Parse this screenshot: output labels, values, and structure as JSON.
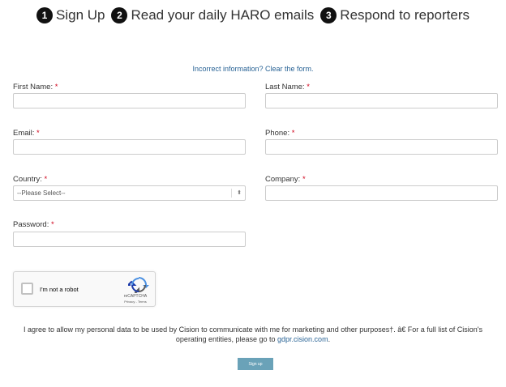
{
  "steps": [
    {
      "num": "1",
      "label": "Sign Up"
    },
    {
      "num": "2",
      "label": "Read your daily HARO emails"
    },
    {
      "num": "3",
      "label": "Respond to reporters"
    }
  ],
  "form": {
    "clear_link": "Incorrect information? Clear the form.",
    "required_mark": "*",
    "first_name_label": "First Name:",
    "last_name_label": "Last Name:",
    "email_label": "Email:",
    "phone_label": "Phone:",
    "country_label": "Country:",
    "company_label": "Company:",
    "password_label": "Password:",
    "country_value": "--Please Select--",
    "first_name_value": "",
    "last_name_value": "",
    "email_value": "",
    "phone_value": "",
    "company_value": "",
    "password_value": ""
  },
  "recaptcha": {
    "label": "I'm not a robot",
    "brand": "reCAPTCHA",
    "links": "Privacy - Terms"
  },
  "consent": {
    "text": "I agree to allow my personal data to be used by Cision to communicate with me for marketing and other purposes†. â€ For a full list of Cision's operating entities, please go to",
    "link": "gdpr.cision.com",
    "end": "."
  },
  "submit_label": "Sign up",
  "colors": {
    "link": "#2a6496",
    "required": "#d0021b",
    "button": "#6aa2b8"
  }
}
